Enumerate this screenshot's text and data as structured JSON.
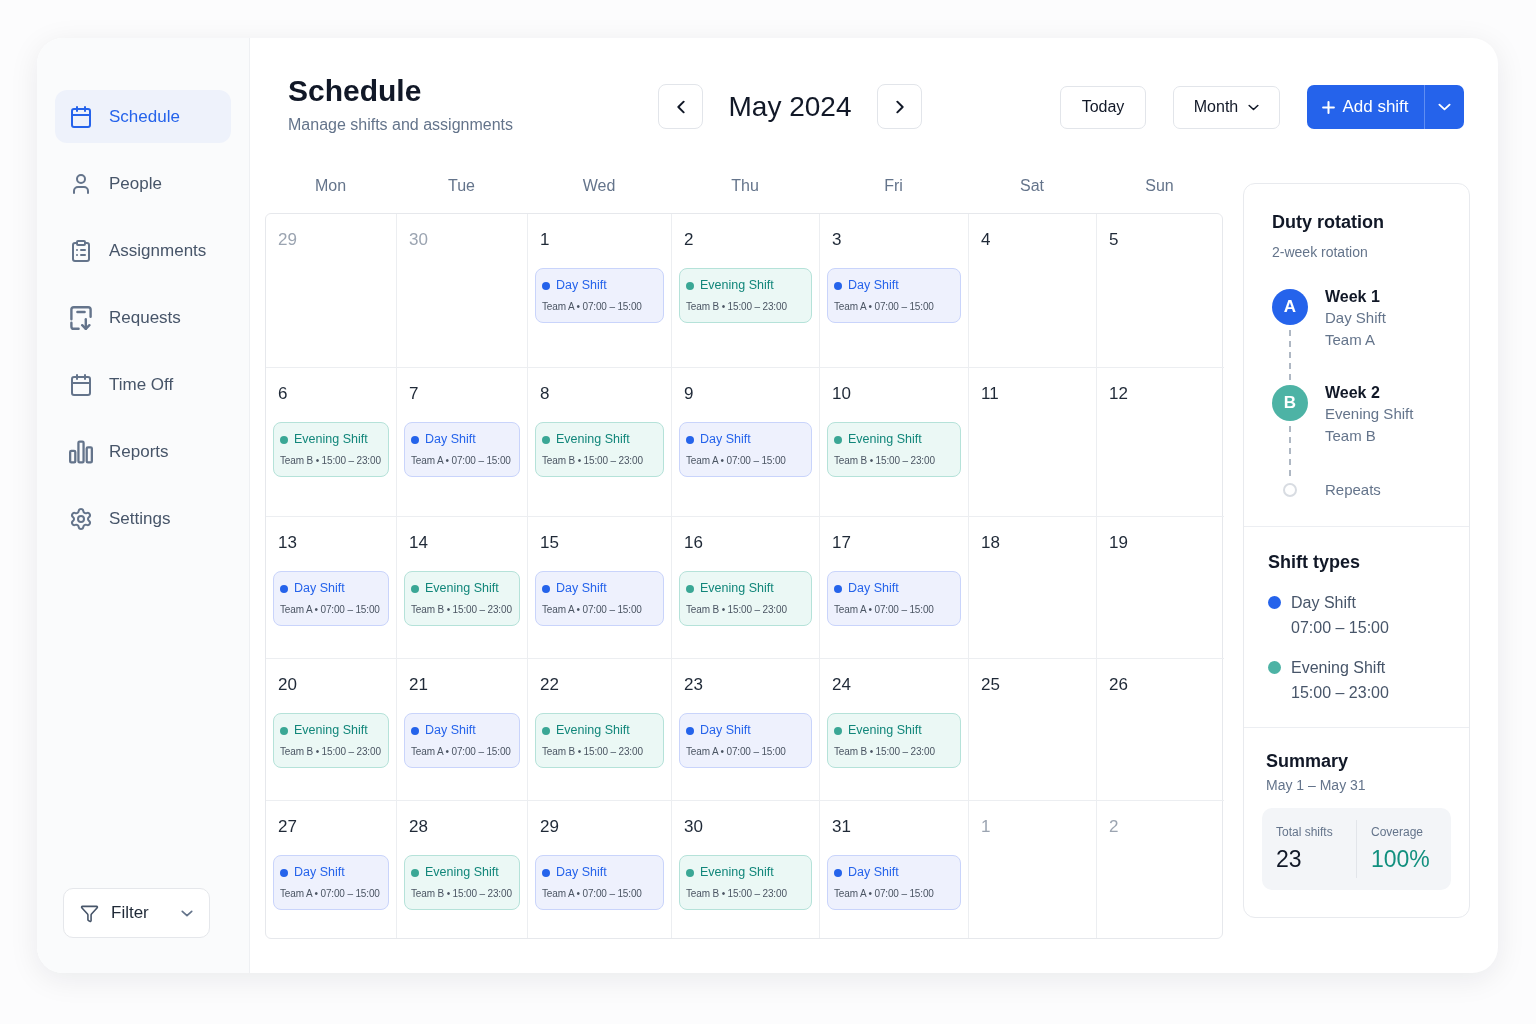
{
  "sidebar": {
    "items": [
      {
        "label": "Schedule",
        "selected": true
      },
      {
        "label": "People",
        "selected": false
      },
      {
        "label": "Assignments",
        "selected": false
      },
      {
        "label": "Requests",
        "selected": false
      },
      {
        "label": "Time Off",
        "selected": false
      },
      {
        "label": "Reports",
        "selected": false
      },
      {
        "label": "Settings",
        "selected": false
      }
    ],
    "filter": {
      "label": "Filter"
    }
  },
  "header": {
    "title": "Schedule",
    "subtitle": "Manage shifts and assignments",
    "month": "May 2024",
    "today_button": "Today",
    "view_select": "Month",
    "add_button": "Add shift"
  },
  "calendar": {
    "weekdays": [
      "Mon",
      "Tue",
      "Wed",
      "Thu",
      "Fri",
      "Sat",
      "Sun"
    ],
    "weeks": [
      {
        "days": [
          {
            "date": "29",
            "outside": true
          },
          {
            "date": "30",
            "outside": true
          },
          {
            "date": "1",
            "outside": false,
            "shift": {
              "kind": "day",
              "title": "Day Shift",
              "detail": "Team A • 07:00 – 15:00"
            }
          },
          {
            "date": "2",
            "outside": false,
            "shift": {
              "kind": "evening",
              "title": "Evening Shift",
              "detail": "Team B • 15:00 – 23:00"
            }
          },
          {
            "date": "3",
            "outside": false,
            "shift": {
              "kind": "day",
              "title": "Day Shift",
              "detail": "Team A • 07:00 – 15:00"
            }
          },
          {
            "date": "4",
            "outside": false
          },
          {
            "date": "5",
            "outside": false
          }
        ]
      },
      {
        "days": [
          {
            "date": "6",
            "outside": false,
            "shift": {
              "kind": "evening",
              "title": "Evening Shift",
              "detail": "Team B • 15:00 – 23:00"
            }
          },
          {
            "date": "7",
            "outside": false,
            "shift": {
              "kind": "day",
              "title": "Day Shift",
              "detail": "Team A • 07:00 – 15:00"
            }
          },
          {
            "date": "8",
            "outside": false,
            "shift": {
              "kind": "evening",
              "title": "Evening Shift",
              "detail": "Team B • 15:00 – 23:00"
            }
          },
          {
            "date": "9",
            "outside": false,
            "shift": {
              "kind": "day",
              "title": "Day Shift",
              "detail": "Team A • 07:00 – 15:00"
            }
          },
          {
            "date": "10",
            "outside": false,
            "shift": {
              "kind": "evening",
              "title": "Evening Shift",
              "detail": "Team B • 15:00 – 23:00"
            }
          },
          {
            "date": "11",
            "outside": false
          },
          {
            "date": "12",
            "outside": false
          }
        ]
      },
      {
        "days": [
          {
            "date": "13",
            "outside": false,
            "shift": {
              "kind": "day",
              "title": "Day Shift",
              "detail": "Team A • 07:00 – 15:00"
            }
          },
          {
            "date": "14",
            "outside": false,
            "shift": {
              "kind": "evening",
              "title": "Evening Shift",
              "detail": "Team B • 15:00 – 23:00"
            }
          },
          {
            "date": "15",
            "outside": false,
            "shift": {
              "kind": "day",
              "title": "Day Shift",
              "detail": "Team A • 07:00 – 15:00"
            }
          },
          {
            "date": "16",
            "outside": false,
            "shift": {
              "kind": "evening",
              "title": "Evening Shift",
              "detail": "Team B • 15:00 – 23:00"
            }
          },
          {
            "date": "17",
            "outside": false,
            "shift": {
              "kind": "day",
              "title": "Day Shift",
              "detail": "Team A • 07:00 – 15:00"
            }
          },
          {
            "date": "18",
            "outside": false
          },
          {
            "date": "19",
            "outside": false
          }
        ]
      },
      {
        "days": [
          {
            "date": "20",
            "outside": false,
            "shift": {
              "kind": "evening",
              "title": "Evening Shift",
              "detail": "Team B • 15:00 – 23:00"
            }
          },
          {
            "date": "21",
            "outside": false,
            "shift": {
              "kind": "day",
              "title": "Day Shift",
              "detail": "Team A • 07:00 – 15:00"
            }
          },
          {
            "date": "22",
            "outside": false,
            "shift": {
              "kind": "evening",
              "title": "Evening Shift",
              "detail": "Team B • 15:00 – 23:00"
            }
          },
          {
            "date": "23",
            "outside": false,
            "shift": {
              "kind": "day",
              "title": "Day Shift",
              "detail": "Team A • 07:00 – 15:00"
            }
          },
          {
            "date": "24",
            "outside": false,
            "shift": {
              "kind": "evening",
              "title": "Evening Shift",
              "detail": "Team B • 15:00 – 23:00"
            }
          },
          {
            "date": "25",
            "outside": false
          },
          {
            "date": "26",
            "outside": false
          }
        ]
      },
      {
        "days": [
          {
            "date": "27",
            "outside": false,
            "shift": {
              "kind": "day",
              "title": "Day Shift",
              "detail": "Team A • 07:00 – 15:00"
            }
          },
          {
            "date": "28",
            "outside": false,
            "shift": {
              "kind": "evening",
              "title": "Evening Shift",
              "detail": "Team B • 15:00 – 23:00"
            }
          },
          {
            "date": "29",
            "outside": false,
            "shift": {
              "kind": "day",
              "title": "Day Shift",
              "detail": "Team A • 07:00 – 15:00"
            }
          },
          {
            "date": "30",
            "outside": false,
            "shift": {
              "kind": "evening",
              "title": "Evening Shift",
              "detail": "Team B • 15:00 – 23:00"
            }
          },
          {
            "date": "31",
            "outside": false,
            "shift": {
              "kind": "day",
              "title": "Day Shift",
              "detail": "Team A • 07:00 – 15:00"
            }
          },
          {
            "date": "1",
            "outside": true
          },
          {
            "date": "2",
            "outside": true
          }
        ]
      }
    ]
  },
  "rotation": {
    "title": "Duty rotation",
    "subtitle": "2-week rotation",
    "steps": [
      {
        "badge": "A",
        "color": "#2563eb",
        "week": "Week 1",
        "shift": "Day Shift",
        "team": "Team A"
      },
      {
        "badge": "B",
        "color": "#4db3a5",
        "week": "Week 2",
        "shift": "Evening Shift",
        "team": "Team B"
      }
    ],
    "end_label": "Repeats"
  },
  "shift_types": {
    "title": "Shift types",
    "items": [
      {
        "name": "Day Shift",
        "hours": "07:00 – 15:00",
        "color": "#2563eb"
      },
      {
        "name": "Evening Shift",
        "hours": "15:00 – 23:00",
        "color": "#4db3a5"
      }
    ]
  },
  "summary": {
    "title": "Summary",
    "range": "May 1 – May 31",
    "stats": [
      {
        "kind": "count",
        "label": "Total shifts",
        "value": "23"
      },
      {
        "kind": "percent",
        "label": "Coverage",
        "value": "100%"
      }
    ]
  }
}
